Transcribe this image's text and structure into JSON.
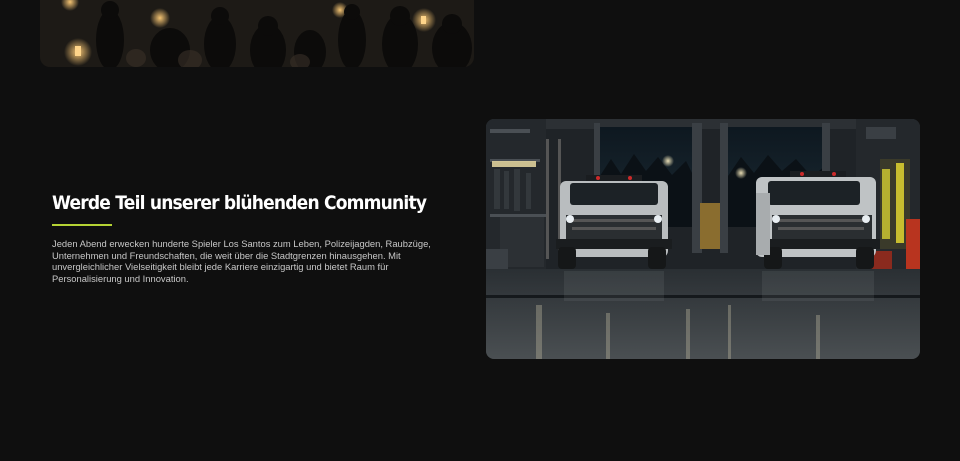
{
  "section": {
    "title": "Werde Teil unserer blühenden Community",
    "body": "Jeden Abend erwecken hunderte Spieler Los Santos zum Leben, Polizeijagden, Raubzüge, Unternehmen und Freundschaften, die weit über die Stadtgrenzen hinausgehen. Mit unvergleichlicher Vielseitigkeit bleibt jede Karriere einzigartig und bietet Raum für Personalisierung und Innovation.",
    "accent_color": "#b5d334"
  },
  "colors": {
    "background": "#0f0f0f",
    "title": "#ffffff",
    "body_text": "#c8c8c8"
  }
}
